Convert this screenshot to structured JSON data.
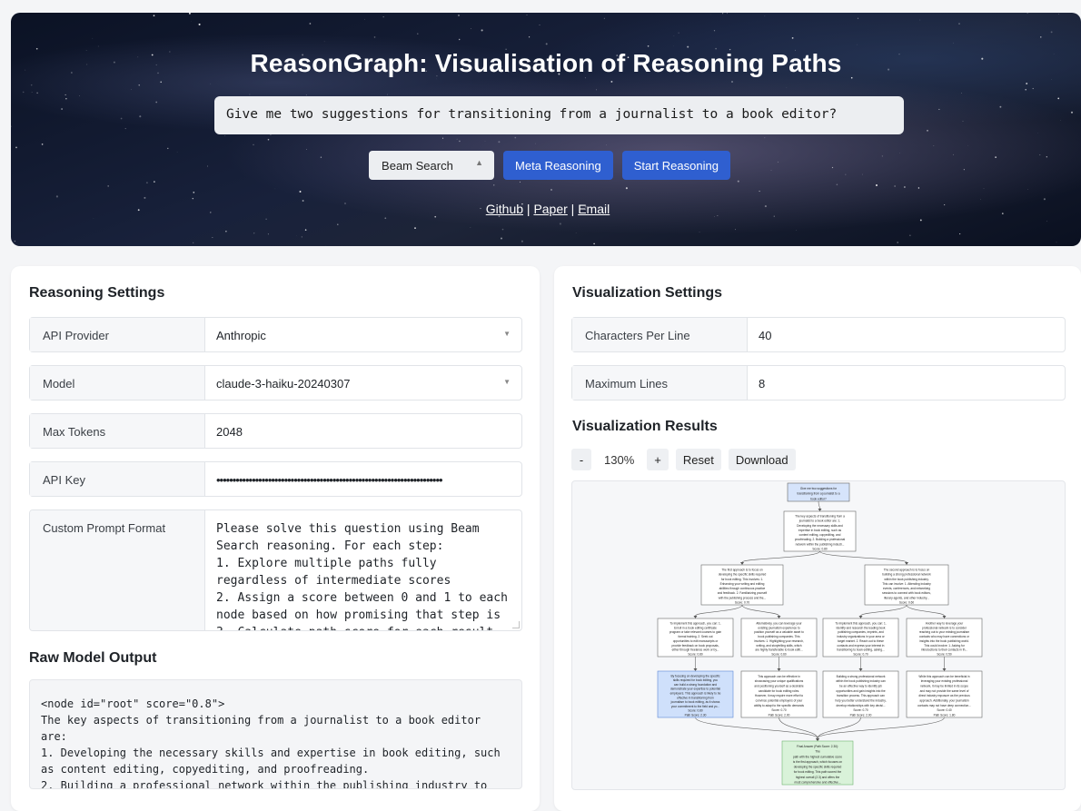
{
  "header": {
    "title": "ReasonGraph: Visualisation of Reasoning Paths",
    "question": "Give me two suggestions for transitioning from a journalist to a book editor?",
    "method_select": "Beam Search",
    "meta_button": "Meta Reasoning",
    "start_button": "Start Reasoning",
    "links": {
      "github": "Github",
      "sep1": " | ",
      "paper": "Paper",
      "sep2": " | ",
      "email": "Email"
    }
  },
  "reasoning_settings": {
    "title": "Reasoning Settings",
    "api_provider": {
      "label": "API Provider",
      "value": "Anthropic"
    },
    "model": {
      "label": "Model",
      "value": "claude-3-haiku-20240307"
    },
    "max_tokens": {
      "label": "Max Tokens",
      "value": "2048"
    },
    "api_key": {
      "label": "API Key",
      "value": "••••••••••••••••••••••••••••••••••••••••••••••••••••••••••••••••••••••"
    },
    "custom_prompt": {
      "label": "Custom Prompt Format",
      "value": "Please solve this question using Beam\nSearch reasoning. For each step:\n1. Explore multiple paths fully\nregardless of intermediate scores\n2. Assign a score between 0 and 1 to each\nnode based on how promising that step is\n3. Calculate path score for each result"
    }
  },
  "raw_output": {
    "title": "Raw Model Output",
    "text": "<node id=\"root\" score=\"0.8\">\nThe key aspects of transitioning from a journalist to a book editor\nare:\n1. Developing the necessary skills and expertise in book editing, such\nas content editing, copyediting, and proofreading.\n2. Building a professional network within the publishing industry to"
  },
  "visualization_settings": {
    "title": "Visualization Settings",
    "chars_per_line": {
      "label": "Characters Per Line",
      "value": "40"
    },
    "max_lines": {
      "label": "Maximum Lines",
      "value": "8"
    }
  },
  "visualization_results": {
    "title": "Visualization Results",
    "zoom_out": "-",
    "zoom_level": "130%",
    "zoom_in": "+",
    "reset": "Reset",
    "download": "Download"
  },
  "graph": {
    "colors": {
      "question": "#d6e4fb",
      "default": "#ffffff",
      "best": "#cfe0fb",
      "final": "#d9f2d9",
      "stroke": "#555555"
    },
    "nodes": {
      "question": [
        "Give me two suggestions for",
        "transitioning from a journalist to a",
        "book editor?"
      ],
      "root": [
        "The key aspects of transitioning from a",
        "journalist to a book editor are: 1.",
        "Developing the necessary skills and",
        "expertise in book editing, such as",
        "content editing, copyediting, and",
        "proofreading. 2. Building a professional",
        "network within the publishing industr...",
        "Score: 0.80"
      ],
      "a": [
        "The first approach is to focus on",
        "developing the specific skills required",
        "for book editing. This involves: 1.",
        "Enhancing your writing and editing",
        "abilities through continuous practice",
        "and feedback. 2. Familiarizing yourself",
        "with the publishing process and the...",
        "Score: 0.70"
      ],
      "b": [
        "The second approach is to focus on",
        "building a strong professional network",
        "within the book publishing industry.",
        "This can involve: 1. Attending industry",
        "events, conferences, and networking",
        "sessions to connect with book editors,",
        "literary agents, and other industry...",
        "Score: 0.60"
      ],
      "a1": [
        "To implement this approach, you can: 1.",
        "Enroll in a book editing certificate",
        "program or take relevant courses to gain",
        "formal training. 2. Seek out",
        "opportunities to edit manuscripts or",
        "provide feedback on book proposals,",
        "either through freelance work or by...",
        "Score: 0.80"
      ],
      "a2": [
        "Alternatively, you can leverage your",
        "existing journalism experience to",
        "position yourself as a valuable asset to",
        "book publishing companies. This",
        "involves: 1. Highlighting your research,",
        "writing, and storytelling skills, which",
        "are highly transferable to book editi...",
        "Score: 0.60"
      ],
      "b1": [
        "To implement this approach, you can: 1.",
        "Identify and research the leading book",
        "publishing companies, imprints, and",
        "industry organizations in your area or",
        "target market. 2. Reach out to these",
        "contacts and express your interest in",
        "transitioning to book editing, asking...",
        "Score: 0.70"
      ],
      "b2": [
        "Another way to leverage your",
        "professional network is to consider",
        "reaching out to your existing journalism",
        "contacts who may have connections or",
        "insights into the book publishing world.",
        "This could involve: 1. Asking for",
        "introductions to their contacts in th...",
        "Score: 0.50"
      ],
      "a1r": [
        "By focusing on developing the specific",
        "skills required for book editing, you",
        "can build a strong foundation and",
        "demonstrate your expertise to potential",
        "employers. This approach is likely to be",
        "effective in transitioning from",
        "journalism to book editing, as it shows",
        "your commitment to the field and yo...",
        "Score: 0.80",
        "Path Score: 2.30"
      ],
      "a2r": [
        "This approach can be effective in",
        "showcasing your unique qualifications",
        "and positioning yourself as a desirable",
        "candidate for book editing roles.",
        "However, it may require more effort to",
        "convince potential employers of your",
        "ability to adapt to the specific demands",
        "Score: 0.70",
        "Path Score: 2.00"
      ],
      "b1r": [
        "Building a strong professional network",
        "within the book publishing industry can",
        "be an effective way to identify job",
        "opportunities and gain insights into the",
        "transition process. This approach can",
        "help you better understand the industry,",
        "develop relationships with key decisi...",
        "Score: 0.70",
        "Path Score: 2.00"
      ],
      "b2r": [
        "While this approach can be beneficial in",
        "leveraging your existing professional",
        "network, it may be limited in its scope",
        "and may not provide the same level of",
        "direct industry exposure as the previous",
        "approach. Additionally, your journalism",
        "contacts may not have deep connection...",
        "Score: 0.40",
        "Path Score: 1.80"
      ],
      "final": [
        "Final Answer (Path Score: 2.30):",
        "The",
        "path with the highest cumulative score",
        "is the first approach, which focuses on",
        "developing the specific skills required",
        "for book editing. This path scored the",
        "highest overall (2.3) and offers the",
        "most comprehensive and effective..."
      ]
    }
  }
}
